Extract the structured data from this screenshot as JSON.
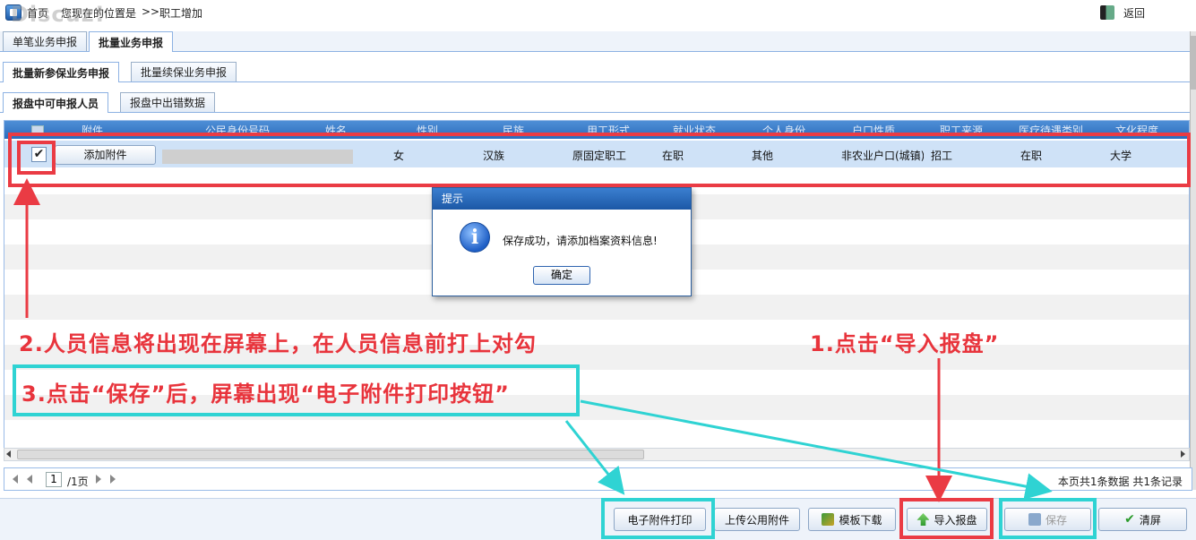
{
  "topbar": {
    "home": "首页",
    "location_label": "您现在的位置是",
    "breadcrumb_sep": ">>",
    "breadcrumb": "职工增加",
    "back": "返回",
    "watermark": "Discuz!"
  },
  "tabs_level1": [
    "单笔业务申报",
    "批量业务申报"
  ],
  "tabs_level2": [
    "批量新参保业务申报",
    "批量续保业务申报"
  ],
  "tabs_level3": [
    "报盘中可申报人员",
    "报盘中出错数据"
  ],
  "grid": {
    "columns": [
      "附件",
      "公民身份号码",
      "姓名",
      "性别",
      "民族",
      "用工形式",
      "就业状态",
      "个人身份",
      "户口性质",
      "职工来源",
      "医疗待遇类别",
      "文化程度"
    ],
    "row": {
      "checked": "✔",
      "attach_button": "添加附件",
      "gender": "女",
      "ethnicity": "汉族",
      "employment_form": "原固定职工",
      "employment_status": "在职",
      "identity": "其他",
      "hukou": "非农业户口(城镇)",
      "source": "招工",
      "medical_category": "在职",
      "education": "大学"
    }
  },
  "pager": {
    "page": "1",
    "total": "/1页",
    "info": "本页共1条数据 共1条记录"
  },
  "toolbar": {
    "print_attachments": "电子附件打印",
    "upload_public": "上传公用附件",
    "template_download": "模板下载",
    "import_disk": "导入报盘",
    "save": "保存",
    "clear": "清屏"
  },
  "modal": {
    "title": "提示",
    "message": "保存成功，请添加档案资料信息!",
    "ok": "确定"
  },
  "annotations": {
    "step1": "1.点击“导入报盘”",
    "step2": "2.人员信息将出现在屏幕上，在人员信息前打上对勾",
    "step3": "3.点击“保存”后，屏幕出现“电子附件打印按钮”"
  },
  "colors": {
    "annotation_red": "#ea3b44",
    "annotation_cyan": "#2fd3d3",
    "header_blue": "#2a6bbd"
  }
}
